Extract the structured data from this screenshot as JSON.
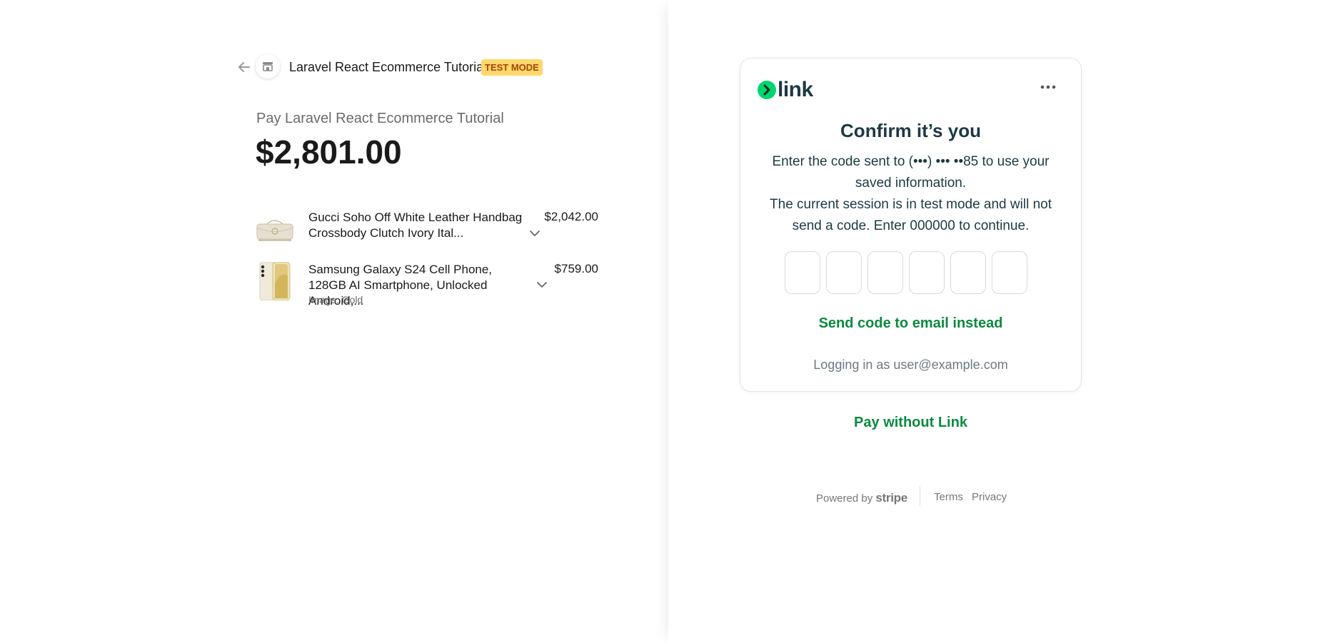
{
  "merchant": {
    "name": "Laravel React Ecommerce Tutorial",
    "badge": "TEST MODE"
  },
  "summary": {
    "pay_label": "Pay Laravel React Ecommerce Tutorial",
    "amount": "$2,801.00"
  },
  "items": [
    {
      "name": "Gucci Soho Off White Leather Handbag Crossbody Clutch Ivory Ital...",
      "price": "$2,042.00",
      "variant": ""
    },
    {
      "name": "Samsung Galaxy S24 Cell Phone, 128GB AI Smartphone, Unlocked Android,...",
      "price": "$759.00",
      "variant": "Image: Gold"
    }
  ],
  "link_card": {
    "logo_text": "link",
    "title": "Confirm it’s you",
    "description_line1": "Enter the code sent to (•••) ••• ••85 to use your saved information.",
    "description_line2": "The current session is in test mode and will not send a code. Enter 000000 to continue.",
    "otp_values": [
      "",
      "",
      "",
      "",
      "",
      ""
    ],
    "send_email_label": "Send code to email instead",
    "logged_in_text": "Logging in as user@example.com"
  },
  "pay_without_link_label": "Pay without Link",
  "footer": {
    "powered_by": "Powered by",
    "brand": "stripe",
    "terms": "Terms",
    "privacy": "Privacy"
  },
  "colors": {
    "accent_green": "#0b8a3f",
    "link_green": "#00d66f",
    "badge_bg": "#ffd76a",
    "badge_text": "#a2470a"
  },
  "icons": [
    "back-arrow-icon",
    "store-icon",
    "chevron-down-icon",
    "more-options-icon",
    "link-logo-icon"
  ]
}
